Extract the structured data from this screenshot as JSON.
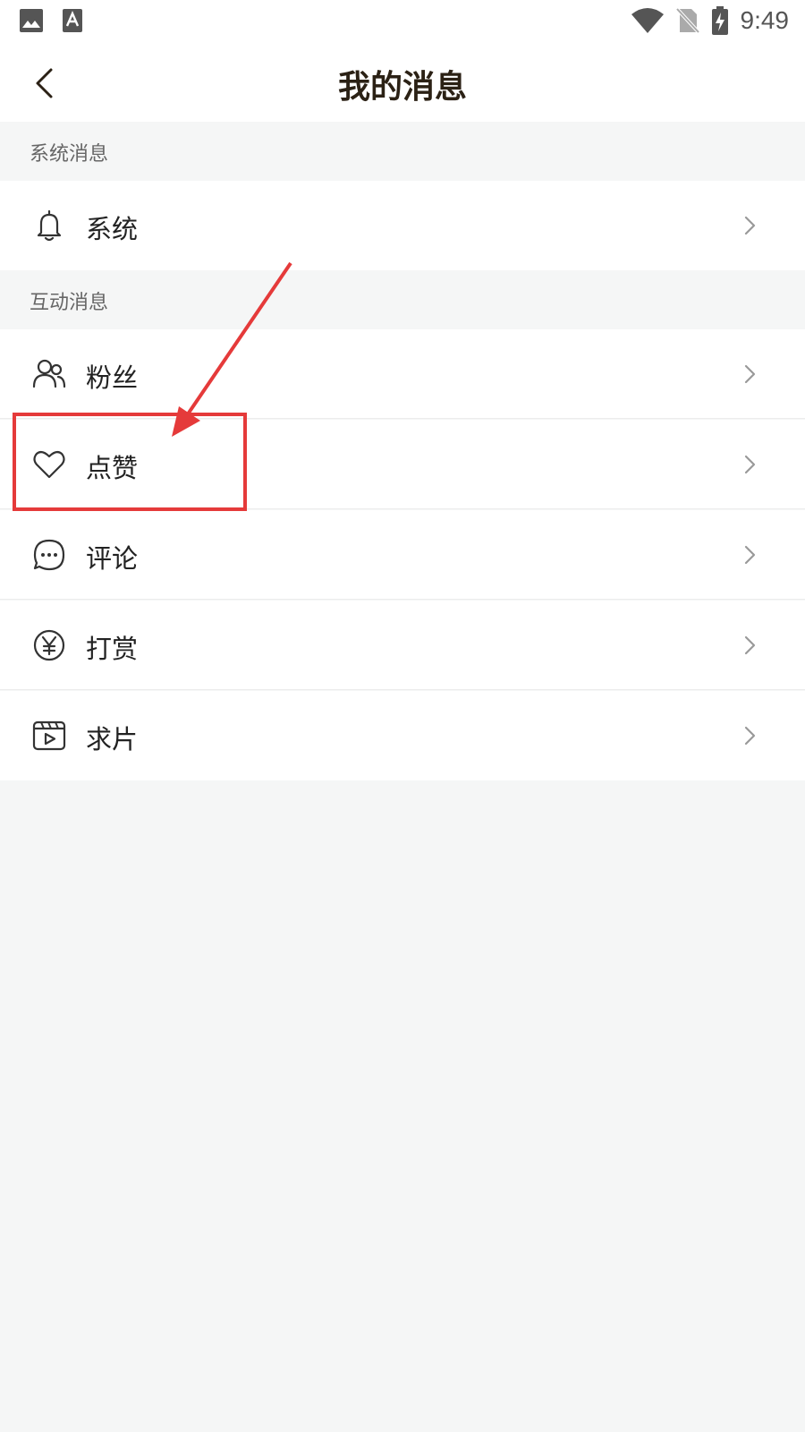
{
  "status_bar": {
    "time": "9:49",
    "icons": [
      "image-notification-icon",
      "a-notification-icon",
      "wifi-icon",
      "no-sim-icon",
      "battery-charging-icon"
    ]
  },
  "header": {
    "title": "我的消息",
    "back_icon": "back-arrow-icon"
  },
  "sections": [
    {
      "title": "系统消息",
      "items": [
        {
          "label": "系统",
          "icon": "bell-icon"
        }
      ]
    },
    {
      "title": "互动消息",
      "items": [
        {
          "label": "粉丝",
          "icon": "fans-icon"
        },
        {
          "label": "点赞",
          "icon": "heart-icon"
        },
        {
          "label": "评论",
          "icon": "comment-icon"
        },
        {
          "label": "打赏",
          "icon": "yen-icon"
        },
        {
          "label": "求片",
          "icon": "video-request-icon"
        }
      ]
    }
  ],
  "colors": {
    "page_background": "#f5f6f6",
    "title_text": "#2b2115",
    "annotation": "#e53a3a"
  }
}
